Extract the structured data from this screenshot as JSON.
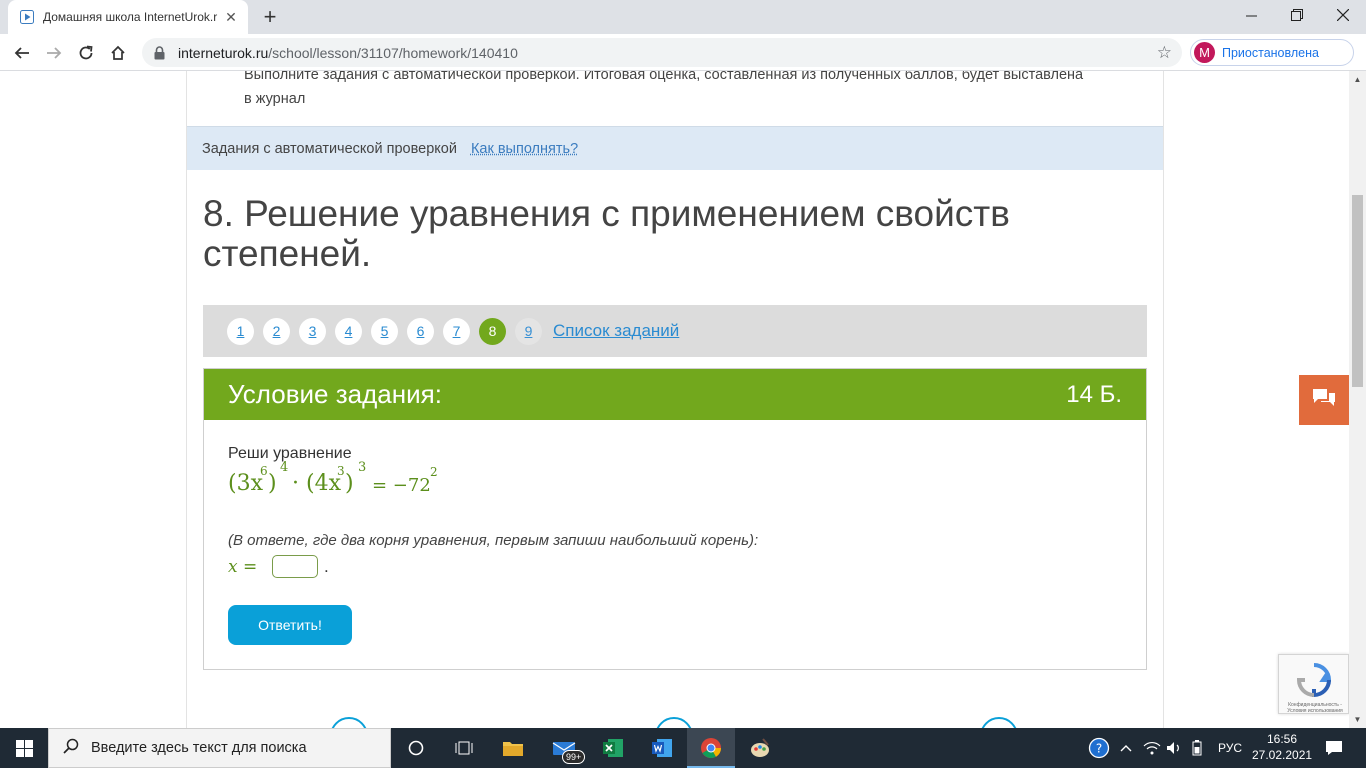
{
  "browser": {
    "tab_title": "Домашняя школа InternetUrok.r",
    "url_host": "interneturok.ru",
    "url_path": "/school/lesson/31107/homework/140410",
    "profile_initial": "M",
    "profile_label": "Приостановлена"
  },
  "page": {
    "intro_line1": "Выполните задания с автоматической проверкой. Итоговая оценка, составленная из полученных баллов, будет выставлена",
    "intro_line2": "в журнал",
    "info_label": "Задания с автоматической проверкой",
    "info_link": "Как выполнять?",
    "task_title": "8. Решение уравнения с применением свойств степеней.",
    "task_numbers": [
      "1",
      "2",
      "3",
      "4",
      "5",
      "6",
      "7",
      "8",
      "9"
    ],
    "active_task": "8",
    "task_list_link": "Список заданий",
    "condition_title": "Условие задания:",
    "condition_points": "14 Б.",
    "task_text": "Реши уравнение",
    "hint": "(В ответе, где два корня уравнения, первым запиши наибольший корень):",
    "answer_prefix": "x =",
    "answer_value": "",
    "answer_suffix": ".",
    "submit_label": "Ответить!",
    "captcha_text": "Конфиденциальность - Условия использования"
  },
  "equation": {
    "p1": "(3x",
    "e1": "6",
    "p2": ")",
    "e2": "4",
    "p3": "· (4x",
    "e3": "3",
    "p4": ")",
    "e4": "3",
    "p5": "= −72",
    "e5": "2"
  },
  "taskbar": {
    "search_placeholder": "Введите здесь текст для поиска",
    "mail_badge": "99+",
    "lang": "РУС",
    "time": "16:56",
    "date": "27.02.2021"
  },
  "colors": {
    "green_accent": "#72a81d",
    "blue_button": "#0aa0d8",
    "chat_orange": "#e16b3c"
  }
}
